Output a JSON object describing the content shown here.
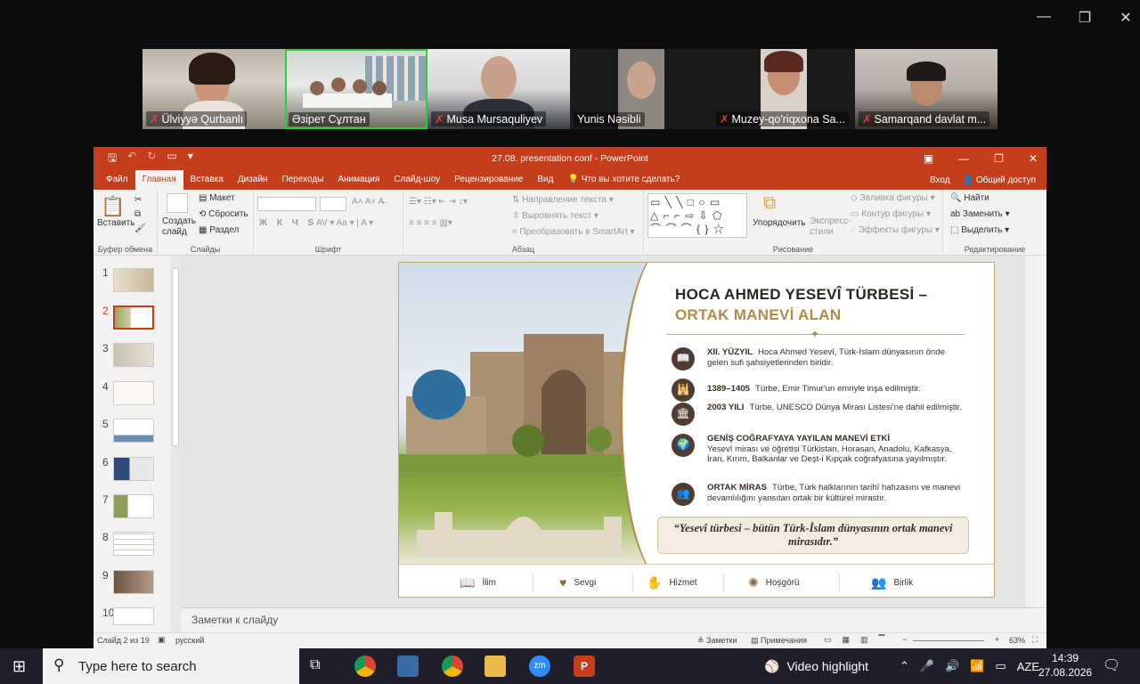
{
  "window_controls": {
    "minimize": "—",
    "restore": "❐",
    "close": "✕"
  },
  "participants": [
    {
      "name": "Ülviyyə Qurbanlı",
      "muted": true
    },
    {
      "name": "Әзірет Сұлтан",
      "muted": false
    },
    {
      "name": "Musa Mursaquliyev",
      "muted": true
    },
    {
      "name": "Yunis Nəsibli",
      "muted": false
    },
    {
      "name": "Muzey-qo'riqxona Sa...",
      "muted": true
    },
    {
      "name": "Samarqand davlat m...",
      "muted": true
    }
  ],
  "ppt": {
    "title": "27.08. presentation conf - PowerPoint",
    "tabs": [
      "Файл",
      "Главная",
      "Вставка",
      "Дизайн",
      "Переходы",
      "Анимация",
      "Слайд-шоу",
      "Рецензирование",
      "Вид"
    ],
    "tell_me": "Что вы хотите сделать?",
    "sign_in": "Вход",
    "share": "Общий доступ",
    "ribbon": {
      "paste": "Вставить",
      "clipboard": "Буфер обмена",
      "new_slide": "Создать слайд",
      "layout": "Макет",
      "reset": "Сбросить",
      "section": "Раздел",
      "slides": "Слайды",
      "font": "Шрифт",
      "paragraph": "Абзац",
      "text_direction": "Направление текста",
      "align_text": "Выровнять текст",
      "smartart": "Преобразовать в SmartArt",
      "arrange": "Упорядочить",
      "express_styles": "Экспресс-стили",
      "shape_fill": "Заливка фигуры",
      "shape_outline": "Контур фигуры",
      "shape_effects": "Эффекты фигуры",
      "drawing": "Рисование",
      "find": "Найти",
      "replace": "Заменить",
      "select": "Выделить",
      "editing": "Редактирование",
      "font_buttons": "Ж К Ч S"
    },
    "thumb_numbers": [
      "1",
      "2",
      "3",
      "4",
      "5",
      "6",
      "7",
      "8",
      "9",
      "10"
    ],
    "notes_placeholder": "Заметки к слайду",
    "status": {
      "slide": "Слайд 2 из 19",
      "lang": "русский",
      "notes": "Заметки",
      "comments": "Примечания",
      "zoom": "63%"
    }
  },
  "slide": {
    "title_line1": "HOCA AHMED YESEVÎ TÜRBESİ –",
    "title_line2": "ORTAK MANEVİ ALAN",
    "items": [
      {
        "icon": "book-icon",
        "glyph": "📖",
        "label": "XII. YÜZYIL",
        "text": "Hoca Ahmed Yesevî, Türk-İslam dünyasının önde gelen sufi şahsiyetlerinden biridir."
      },
      {
        "icon": "mosque-icon",
        "glyph": "🕌",
        "label": "1389–1405",
        "text": "Türbe, Emir Timur'un emriyle inşa edilmiştir."
      },
      {
        "icon": "museum-icon",
        "glyph": "🏛",
        "label": "2003 YILI",
        "text": "Türbe, UNESCO Dünya Mirası Listesi'ne dahil edilmiştir."
      },
      {
        "icon": "globe-icon",
        "glyph": "🌍",
        "label": "GENİŞ COĞRAFYAYA YAYILAN MANEVİ ETKİ",
        "text": "Yesevî mirası ve öğretisi Türkistan, Horasan, Anadolu, Kafkasya, İran, Kırım, Balkanlar ve Deşt-i Kıpçak coğrafyasına yayılmıştır."
      },
      {
        "icon": "people-icon",
        "glyph": "👥",
        "label": "ORTAK MİRAS",
        "text": "Türbe, Türk halklarının tarihî hafızasını ve manevi devamlılığını yansıtan ortak bir kültürel mirastır."
      }
    ],
    "quote": "“Yesevî türbesi – bütün Türk-İslam dünyasının ortak manevi mirasıdır.”",
    "footer": [
      "İlim",
      "Sevgi",
      "Hizmet",
      "Hoşgörü",
      "Birlik"
    ]
  },
  "taskbar": {
    "search_placeholder": "Type here to search",
    "video_highlight": "Video highlight",
    "lang": "AZE",
    "time": "14:39",
    "date": "27.08.2026"
  }
}
